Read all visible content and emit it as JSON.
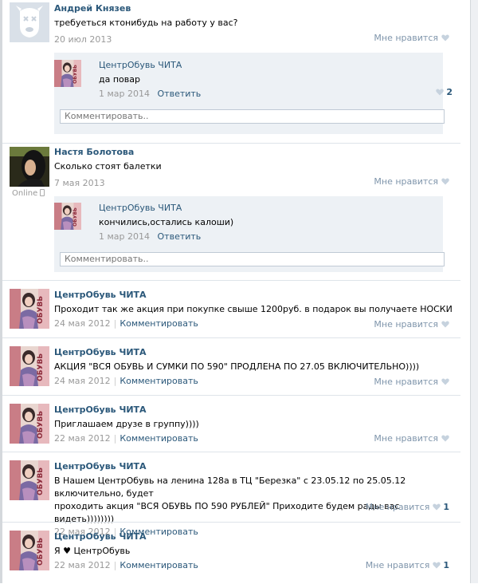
{
  "posts": [
    {
      "author": "Андрей Князев",
      "text": "требуеться ктонибудь на работу у вас?",
      "date": "20 июл 2013",
      "like_label": "Мне нравится",
      "reply": {
        "author": "ЦентрОбувь ЧИТА",
        "text": "да повар",
        "date": "1 мар 2014",
        "answer": "Ответить",
        "like_count": "2"
      },
      "comment_placeholder": "Комментировать.."
    },
    {
      "author": "Настя Болотова",
      "online": "Online",
      "text": "Сколько стоят балетки",
      "date": "7 мая 2013",
      "like_label": "Мне нравится",
      "reply": {
        "author": "ЦентрОбувь ЧИТА",
        "text": "кончились,остались калоши)",
        "date": "1 мар 2014",
        "answer": "Ответить"
      },
      "comment_placeholder": "Комментировать.."
    },
    {
      "author": "ЦентрОбувь ЧИТА",
      "text": "Проходит так же акция при покупке свыше 1200руб. в подарок вы получаете НОСКИ",
      "date": "24 мая 2012",
      "comment": "Комментировать",
      "like_label": "Мне нравится"
    },
    {
      "author": "ЦентрОбувь ЧИТА",
      "text": "АКЦИЯ \"ВСЯ ОБУВЬ И СУМКИ ПО 590\" ПРОДЛЕНА ПО 27.05 ВКЛЮЧИТЕЛЬНО))))",
      "date": "24 мая 2012",
      "comment": "Комментировать",
      "like_label": "Мне нравится"
    },
    {
      "author": "ЦентрОбувь ЧИТА",
      "text": "Приглашаем друзе в группу))))",
      "date": "22 мая 2012",
      "comment": "Комментировать",
      "like_label": "Мне нравится"
    },
    {
      "author": "ЦентрОбувь ЧИТА",
      "text_line1": "В Нашем ЦентрОбувь на ленина 128а в ТЦ \"Березка\" с 23.05.12 по 25.05.12 включительно, будет",
      "text_line2": "проходить акция \"ВСЯ ОБУВЬ ПО 590 РУБЛЕЙ\" Приходите будем рады вас видеть))))))))",
      "date": "22 мая 2012",
      "comment": "Комментировать",
      "like_label": "Мне нравится",
      "like_count": "1"
    },
    {
      "author": "ЦентрОбувь ЧИТА",
      "text": "Я ♥ ЦентрОбувь",
      "date": "22 мая 2012",
      "comment": "Комментировать",
      "like_label": "Мне нравится",
      "like_count": "1"
    }
  ],
  "avatar_logo_text": "ОБУВЬ",
  "colors": {
    "link": "#2b587a",
    "meta": "#999999",
    "reply_bg": "#edf1f5",
    "separator": "#dee4ea"
  }
}
